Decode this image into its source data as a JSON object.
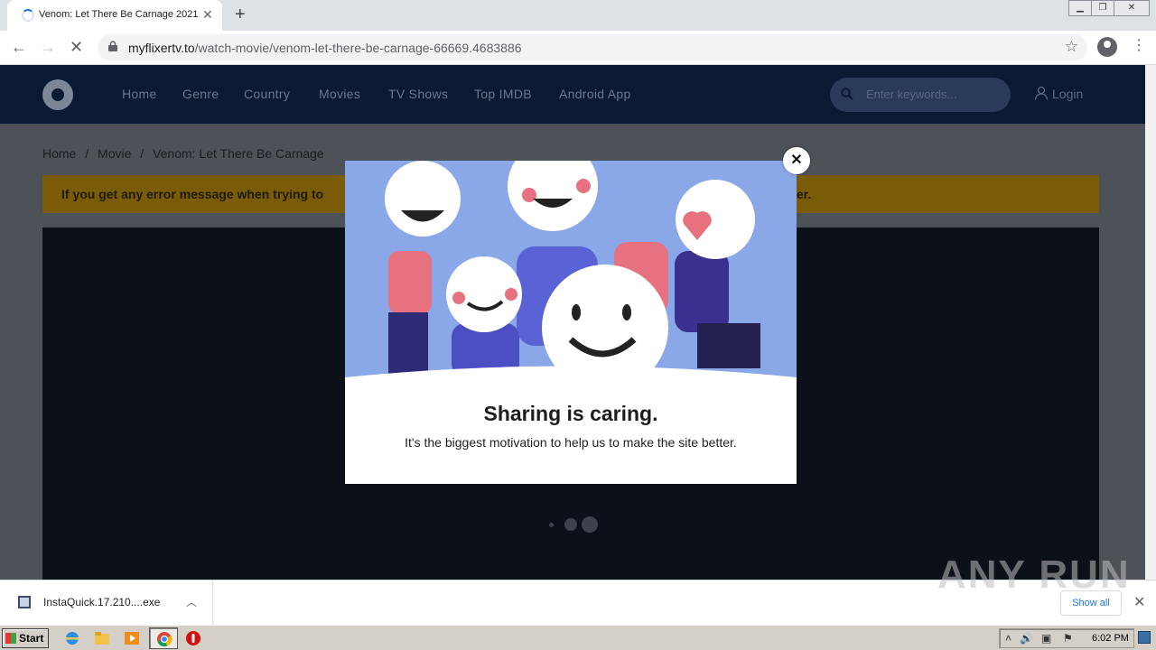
{
  "browser": {
    "tab_title": "Venom: Let There Be Carnage 2021",
    "tab_close": "✕",
    "new_tab": "+",
    "url_host": "myflixertv.to",
    "url_path": "/watch-movie/venom-let-there-be-carnage-66669.4683886",
    "back": "←",
    "forward": "→",
    "stop": "✕",
    "star": "☆",
    "menu": "⋮",
    "win_minimize": "▁",
    "win_restore": "❐",
    "win_close": "✕"
  },
  "site": {
    "nav": [
      "Home",
      "Genre",
      "Country",
      "Movies",
      "TV Shows",
      "Top IMDB",
      "Android App"
    ],
    "search_placeholder": "Enter keywords...",
    "login": "Login"
  },
  "page": {
    "breadcrumb": [
      "Home",
      "/",
      "Movie",
      "/",
      "Venom: Let There Be Carnage"
    ],
    "alert_left": "If you get any error message when trying to",
    "alert_right": "er."
  },
  "modal": {
    "close": "✕",
    "heading": "Sharing is caring.",
    "subtext": "It's the biggest motivation to help us to make the site better."
  },
  "downloads": {
    "file_name": "InstaQuick.17.210....exe",
    "chevron": "︿",
    "show_all": "Show all",
    "close": "✕"
  },
  "watermark": "ANY RUN",
  "taskbar": {
    "start": "Start",
    "clock": "6:02 PM"
  },
  "colors": {
    "site_header": "#0a1a33",
    "alert": "#f5b70c",
    "modal_sky": "#8aa7e8",
    "accent_pink": "#e8717f",
    "accent_navy": "#3b2f8f"
  }
}
